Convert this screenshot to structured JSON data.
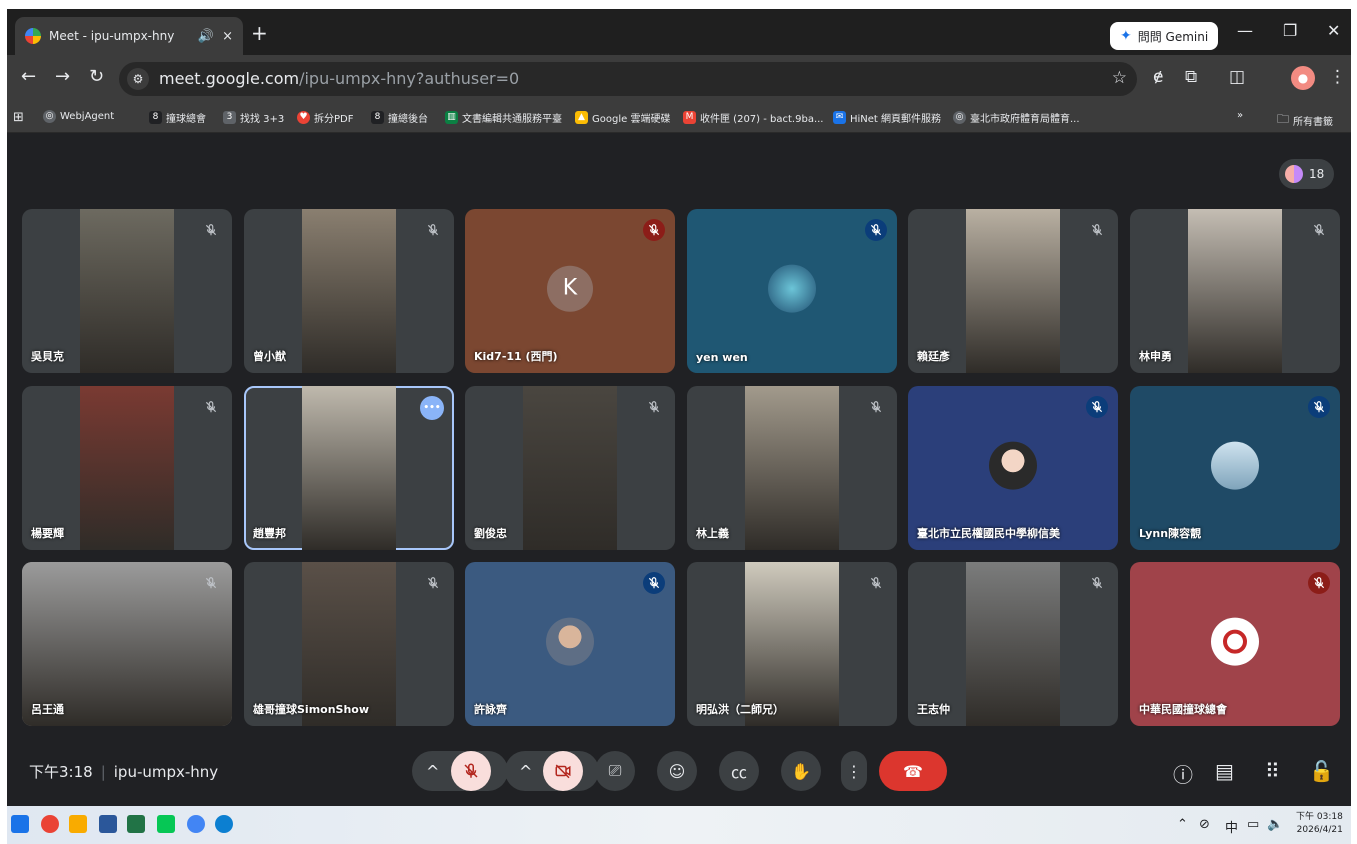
{
  "browser": {
    "tab_title": "Meet - ipu-umpx-hny",
    "tab_sound": "🔊",
    "tab_close": "×",
    "new_tab": "+",
    "gemini_label": "問問 Gemini",
    "url_host": "meet.google.com",
    "url_path": "/ipu-umpx-hny?authuser=0",
    "bookmarks": [
      "WebjAgent",
      "撞球總會",
      "找找 3+3",
      "拆分PDF",
      "撞總後台",
      "文書編輯共通服務平臺",
      "Google 雲端硬碟",
      "收件匣 (207) - bact.9ba...",
      "HiNet 網頁郵件服務",
      "臺北市政府體育局體育...",
      "所有書籤"
    ]
  },
  "meet": {
    "participant_count": "18",
    "time": "下午3:18",
    "meeting_code": "ipu-umpx-hny",
    "tiles": [
      {
        "name": "吳貝克",
        "mic": "plain",
        "bg": "#3c4043",
        "vid": "#6d6a60"
      },
      {
        "name": "曾小猷",
        "mic": "plain",
        "bg": "#3c4043",
        "vid": "#8a7f70"
      },
      {
        "name": "Kid7-11 (西門)",
        "mic": "red",
        "bg": "#7b4731",
        "initial": "K"
      },
      {
        "name": "yen wen",
        "mic": "blue",
        "bg": "#1f5773",
        "avatar": "globe"
      },
      {
        "name": "賴廷彥",
        "mic": "plain",
        "bg": "#3c4043",
        "vid": "#b9b0a2"
      },
      {
        "name": "林申勇",
        "mic": "plain",
        "bg": "#3c4043",
        "vid": "#c4bdb3"
      },
      {
        "name": "楊要輝",
        "mic": "plain",
        "bg": "#3c4043",
        "vid": "#7a3a32"
      },
      {
        "name": "趙豐邦",
        "mic": "more",
        "bg": "#3c4043",
        "vid": "#bfb9ad",
        "active": true
      },
      {
        "name": "劉俊忠",
        "mic": "plain",
        "bg": "#3c4043",
        "vid": "#4a4640"
      },
      {
        "name": "林上義",
        "mic": "plain",
        "bg": "#3c4043",
        "vid": "#a29a8c"
      },
      {
        "name": "臺北市立民權國民中學柳信美",
        "mic": "blue",
        "bg": "#2b3f7a",
        "avatar": "person"
      },
      {
        "name": "Lynn陳容靚",
        "mic": "blue",
        "bg": "#1f4a66",
        "avatar": "lake"
      },
      {
        "name": "呂王通",
        "mic": "plain",
        "bg": "#8a8a8a",
        "vid": "#9b9b9b",
        "full": true
      },
      {
        "name": "雄哥撞球SimonShow",
        "mic": "plain",
        "bg": "#3c4043",
        "vid": "#5a5048"
      },
      {
        "name": "許詠齊",
        "mic": "blue",
        "bg": "#3b5a80",
        "avatar": "person2"
      },
      {
        "name": "明弘洪（二師兄）",
        "mic": "plain",
        "bg": "#3c4043",
        "vid": "#cfcabd"
      },
      {
        "name": "王志仲",
        "mic": "plain",
        "bg": "#3c4043",
        "vid": "#7b7c7c"
      },
      {
        "name": "中華民國撞球總會",
        "mic": "red",
        "bg": "#a0434a",
        "avatar": "logo"
      }
    ]
  },
  "taskbar": {
    "ime": "中",
    "time": "下午 03:18",
    "date": "2026/4/21"
  }
}
